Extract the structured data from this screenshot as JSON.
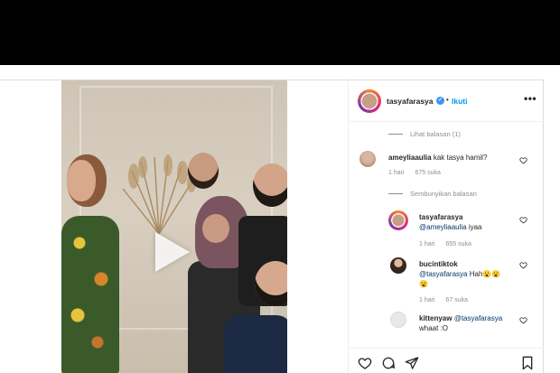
{
  "post": {
    "author": "tasyafarasya",
    "follow_label": "Ikuti",
    "separator": "•"
  },
  "comments": {
    "view_replies_top": "Lihat balasan (1)",
    "hide_replies": "Sembunyikan balasan",
    "main": {
      "username": "ameyliaaulia",
      "text": "kak tasya hamil?",
      "time": "1 hari",
      "likes": "675 suka"
    },
    "replies": [
      {
        "username": "tasyafarasya",
        "mention": "@ameyliaaulia",
        "text": "iyaa",
        "time": "1 hari",
        "likes": "655 suka"
      },
      {
        "username": "bucintiktok",
        "mention": "@tasyafarasya",
        "text": "Hah😮😮",
        "text_line2": "😮",
        "time": "1 hari",
        "likes": "67 suka"
      },
      {
        "username": "kittenyaw",
        "mention": "@tasyafarasya",
        "text_line2": "whaat :O"
      }
    ]
  },
  "icons": {
    "play": "play-icon",
    "verified": "verified-badge-icon",
    "more": "more-options-icon",
    "heart": "heart-icon",
    "comment": "comment-icon",
    "share": "share-icon",
    "save": "bookmark-icon"
  },
  "colors": {
    "link_blue": "#0095f6",
    "verified_blue": "#3897f0",
    "muted_gray": "#8e8e8e",
    "text_dark": "#262626"
  }
}
